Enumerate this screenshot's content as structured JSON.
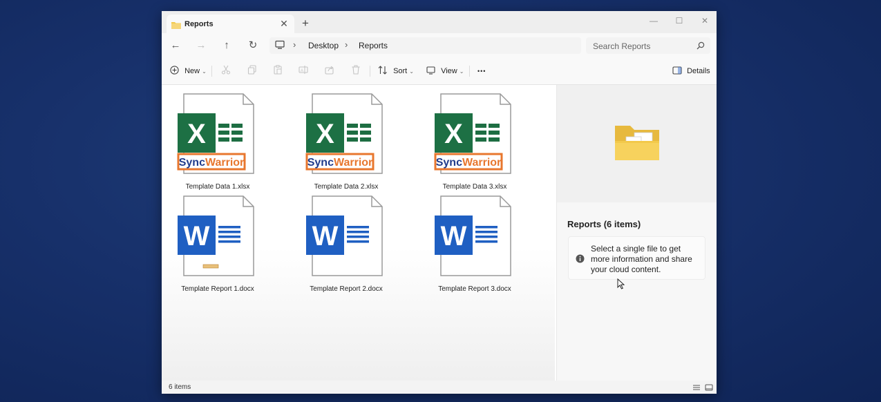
{
  "window": {
    "tab_title": "Reports",
    "new_tab_glyph": "+",
    "tab_close_glyph": "✕",
    "controls": {
      "minimize": "—",
      "maximize": "☐",
      "close": "✕"
    }
  },
  "nav": {
    "back": "←",
    "forward": "→",
    "up": "↑",
    "refresh": "↻",
    "breadcrumb": [
      "Desktop",
      "Reports"
    ],
    "separator": "›",
    "search_placeholder": "Search Reports"
  },
  "commands": {
    "new_label": "New",
    "sort_label": "Sort",
    "view_label": "View",
    "more_label": "•••",
    "details_label": "Details",
    "icons": [
      "cut-icon",
      "copy-icon",
      "paste-icon",
      "rename-icon",
      "share-icon",
      "delete-icon"
    ]
  },
  "files": [
    {
      "name": "Template Data 1.xlsx",
      "type": "excel",
      "badge": "SyncWarrior"
    },
    {
      "name": "Template Data 2.xlsx",
      "type": "excel",
      "badge": "SyncWarrior"
    },
    {
      "name": "Template Data 3.xlsx",
      "type": "excel",
      "badge": "SyncWarrior"
    },
    {
      "name": "Template Report 1.docx",
      "type": "word"
    },
    {
      "name": "Template Report 2.docx",
      "type": "word"
    },
    {
      "name": "Template Report 3.docx",
      "type": "word"
    }
  ],
  "details_pane": {
    "title": "Reports (6 items)",
    "info_text": "Select a single file to get more information and share your cloud content."
  },
  "status": {
    "item_count": "6 items"
  },
  "colors": {
    "excel_green": "#1d7044",
    "excel_bars": "#1e6e43",
    "syncwarrior_orange": "#e8772e",
    "syncwarrior_blue": "#1f3b8c",
    "word_blue": "#1f5fc2",
    "folder_yellow": "#f2c94c"
  }
}
